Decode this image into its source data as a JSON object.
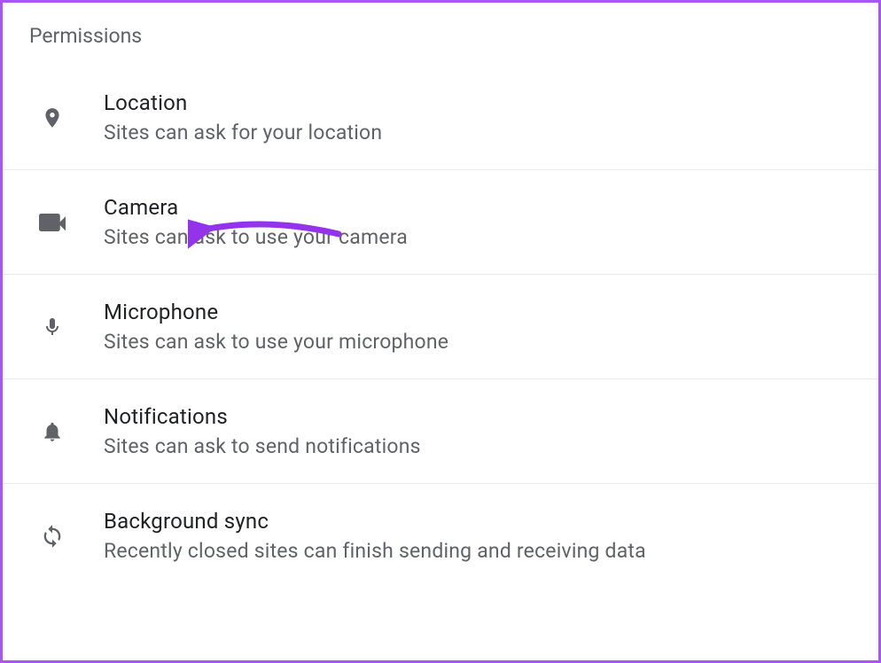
{
  "section_title": "Permissions",
  "permissions": [
    {
      "icon": "location-icon",
      "title": "Location",
      "subtitle": "Sites can ask for your location"
    },
    {
      "icon": "camera-icon",
      "title": "Camera",
      "subtitle": "Sites can ask to use your camera"
    },
    {
      "icon": "microphone-icon",
      "title": "Microphone",
      "subtitle": "Sites can ask to use your microphone"
    },
    {
      "icon": "notifications-icon",
      "title": "Notifications",
      "subtitle": "Sites can ask to send notifications"
    },
    {
      "icon": "sync-icon",
      "title": "Background sync",
      "subtitle": "Recently closed sites can finish sending and receiving data"
    }
  ],
  "annotation": {
    "target": "Camera",
    "color": "#9333ea"
  }
}
